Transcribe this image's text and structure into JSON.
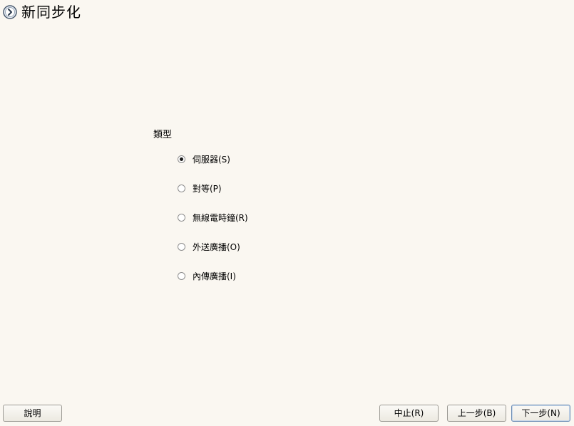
{
  "title": "新同步化",
  "type_group": {
    "label": "類型",
    "options": [
      {
        "label": "伺服器(S)",
        "selected": true
      },
      {
        "label": "對等(P)",
        "selected": false
      },
      {
        "label": "無線電時鐘(R)",
        "selected": false
      },
      {
        "label": "外送廣播(O)",
        "selected": false
      },
      {
        "label": "內傳廣播(I)",
        "selected": false
      }
    ]
  },
  "buttons": {
    "help": "說明",
    "abort": "中止(R)",
    "back": "上一步(B)",
    "next": "下一步(N)"
  }
}
